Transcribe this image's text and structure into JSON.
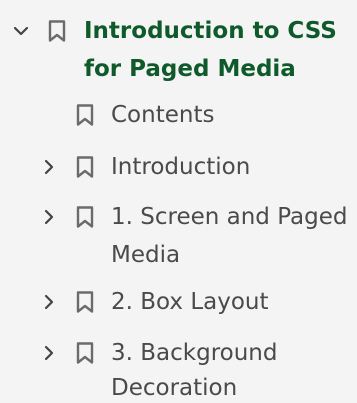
{
  "outline": {
    "root": {
      "line1": "Introduction to CSS",
      "line2": "for Paged Media",
      "expanded": true
    },
    "items": [
      {
        "line1": "Contents",
        "line2": "",
        "expandable": false
      },
      {
        "line1": "Introduction",
        "line2": "",
        "expandable": true
      },
      {
        "line1": "1. Screen and Paged",
        "line2": "Media",
        "expandable": true
      },
      {
        "line1": "2. Box Layout",
        "line2": "",
        "expandable": true
      },
      {
        "line1": "3. Background",
        "line2": "Decoration",
        "expandable": true
      }
    ]
  },
  "colors": {
    "title_text": "#0f5a2b",
    "item_text": "#4a4a4a",
    "icon": "#6b6b6b",
    "background": "#f4f4f4"
  },
  "icons": {
    "expanded": "chevron-down-icon",
    "collapsed": "chevron-right-icon",
    "bookmark": "bookmark-icon"
  }
}
